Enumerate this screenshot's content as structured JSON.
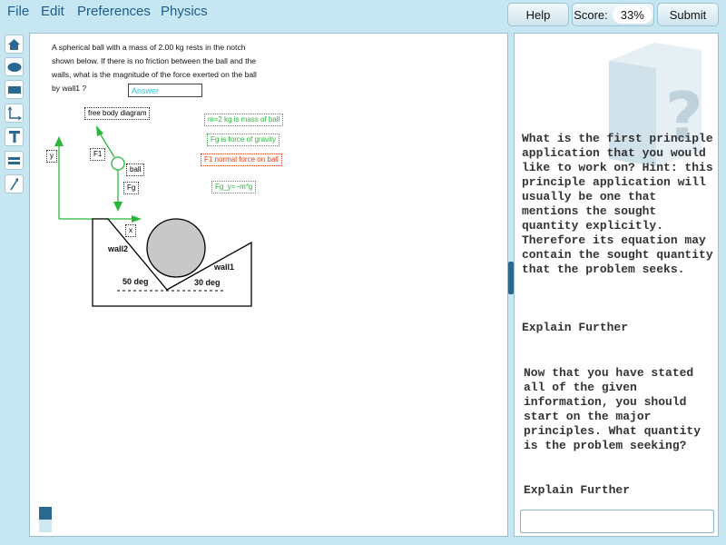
{
  "menu": {
    "file": "File",
    "edit": "Edit",
    "preferences": "Preferences",
    "physics": "Physics"
  },
  "top_buttons": {
    "help": "Help",
    "score_label": "Score:",
    "score_value": "33%",
    "submit": "Submit"
  },
  "toolbar_icons": [
    "home-icon",
    "ellipse-icon",
    "rectangle-icon",
    "axes-icon",
    "text-icon",
    "equation-icon",
    "vector-icon"
  ],
  "problem": {
    "text": "A spherical ball with a mass of 2.00 kg rests in the notch shown below.  If there is no friction between the ball and the walls, what is the magnitude of the force exerted on the ball by wall1 ?",
    "answer_placeholder": "Answer"
  },
  "diagram": {
    "free_body_label": "free body diagram",
    "mass_label": "m=2 kg is mass of ball",
    "gravity_label": "Fg is force of gravity",
    "normal_label": "F1 normal force on ball",
    "equation_label": "Fg_y=−m*g",
    "y_axis": "y",
    "x_axis": "x",
    "f1": "F1",
    "ball": "ball",
    "fg": "Fg",
    "wall2": "wall2",
    "wall1": "wall1",
    "angle_left": "50 deg",
    "angle_right": "30 deg"
  },
  "hints": {
    "hint1": "What is the first principle application that you would like to work on? Hint: this principle application will usually be one that mentions the sought quantity explicitly. Therefore its equation may contain the sought quantity that the problem seeks.",
    "explain1": "Explain Further",
    "hint2": "Now that you have stated all of the given information, you should start on the major principles. What quantity is the problem seeking?",
    "explain2": "Explain Further"
  },
  "colors": {
    "accent": "#2b6890",
    "menu_text": "#1d5d8d",
    "green": "#27b83a",
    "red": "#e43c10",
    "background": "#c6e7f1"
  }
}
